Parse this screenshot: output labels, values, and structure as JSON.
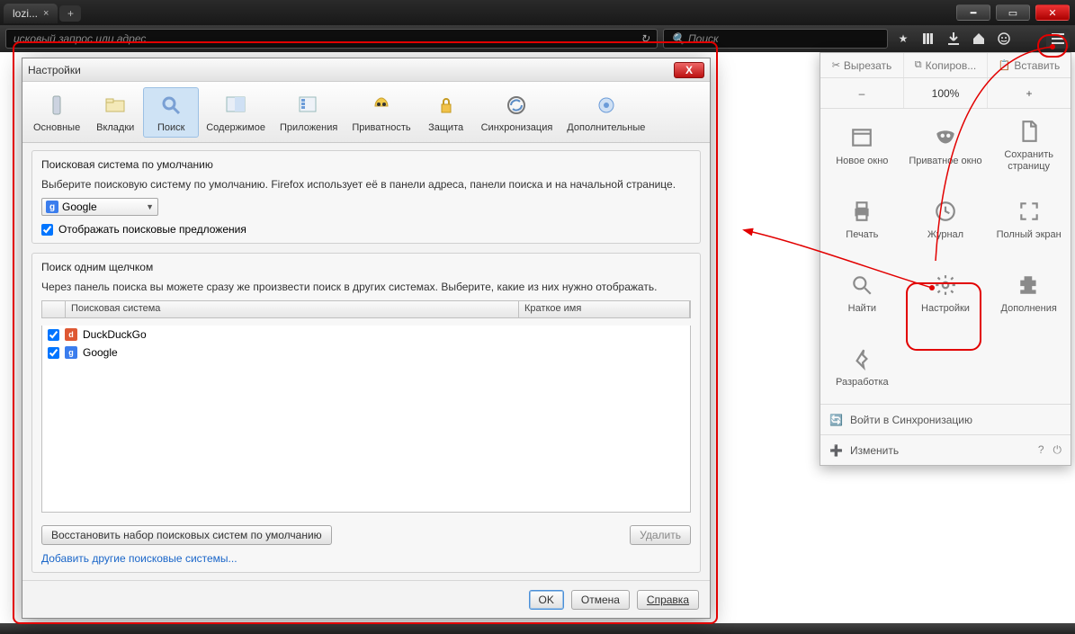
{
  "window": {
    "tab_title": "lozi...",
    "new_tab": "+"
  },
  "toolbar": {
    "url_placeholder": "исковый запрос или адрес",
    "search_placeholder": "Поиск",
    "icons": [
      "star",
      "lib",
      "down",
      "home",
      "face",
      "burger"
    ]
  },
  "menu": {
    "edit": {
      "cut": "Вырезать",
      "copy": "Копиров...",
      "paste": "Вставить"
    },
    "zoom": {
      "minus": "–",
      "value": "100%",
      "plus": "+"
    },
    "items": [
      {
        "icon": "window",
        "label": "Новое окно"
      },
      {
        "icon": "mask",
        "label": "Приватное окно"
      },
      {
        "icon": "page",
        "label": "Сохранить страницу"
      },
      {
        "icon": "print",
        "label": "Печать"
      },
      {
        "icon": "history",
        "label": "Журнал"
      },
      {
        "icon": "fullscreen",
        "label": "Полный экран"
      },
      {
        "icon": "find",
        "label": "Найти"
      },
      {
        "icon": "settings",
        "label": "Настройки"
      },
      {
        "icon": "addons",
        "label": "Дополнения"
      },
      {
        "icon": "dev",
        "label": "Разработка"
      }
    ],
    "sync": "Войти в Синхронизацию",
    "customize": "Изменить"
  },
  "dialog": {
    "title": "Настройки",
    "tabs": [
      {
        "id": "general",
        "label": "Основные"
      },
      {
        "id": "tabs",
        "label": "Вкладки"
      },
      {
        "id": "search",
        "label": "Поиск"
      },
      {
        "id": "content",
        "label": "Содержимое"
      },
      {
        "id": "apps",
        "label": "Приложения"
      },
      {
        "id": "privacy",
        "label": "Приватность"
      },
      {
        "id": "security",
        "label": "Защита"
      },
      {
        "id": "sync",
        "label": "Синхронизация"
      },
      {
        "id": "advanced",
        "label": "Дополнительные"
      }
    ],
    "default_group": {
      "heading": "Поисковая система по умолчанию",
      "desc": "Выберите поисковую систему по умолчанию. Firefox использует её в панели адреса, панели поиска и на начальной странице.",
      "selected": "Google",
      "suggest_label": "Отображать поисковые предложения"
    },
    "oneclick": {
      "heading": "Поиск одним щелчком",
      "desc": "Через панель поиска вы можете сразу же произвести поиск в других системах. Выберите, какие из них нужно отображать.",
      "col_engine": "Поисковая система",
      "col_key": "Краткое имя",
      "engines": [
        {
          "name": "DuckDuckGo",
          "fav": "ddg",
          "checked": true
        },
        {
          "name": "Google",
          "fav": "ggl",
          "checked": true
        }
      ],
      "restore": "Восстановить набор поисковых систем по умолчанию",
      "remove": "Удалить",
      "add_link": "Добавить другие поисковые системы..."
    },
    "footer": {
      "ok": "OK",
      "cancel": "Отмена",
      "help": "Справка"
    }
  }
}
